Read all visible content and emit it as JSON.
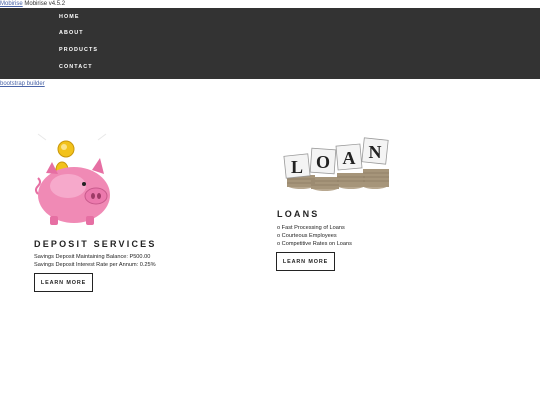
{
  "topline": {
    "brand_link": "Mobirise",
    "version_text": " Mobirise v4.5.2"
  },
  "nav": {
    "items": [
      "HOME",
      "ABOUT",
      "PRODUCTS",
      "CONTACT"
    ]
  },
  "builder_link": "bootstrap builder",
  "deposit": {
    "image_icon": "piggy-bank-icon",
    "title": "DEPOSIT SERVICES",
    "lines": [
      "Savings Deposit Maintaining Balance: P500.00",
      "Savings Deposit Interest Rate per Annum: 0.25%"
    ],
    "button": "LEARN MORE"
  },
  "loans": {
    "image_icon": "loan-blocks-icon",
    "image_letters": [
      "L",
      "O",
      "A",
      "N"
    ],
    "title": "LOANS",
    "lines": [
      "o Fast Processing of Loans",
      "o Courteous Employees",
      "o Competitive Rates on Loans"
    ],
    "button": "LEARN MORE"
  },
  "colors": {
    "navbar": "#333333",
    "text": "#232323",
    "link": "#4a64a8",
    "pig": "#f08ab5",
    "coin": "#f2c21b"
  }
}
